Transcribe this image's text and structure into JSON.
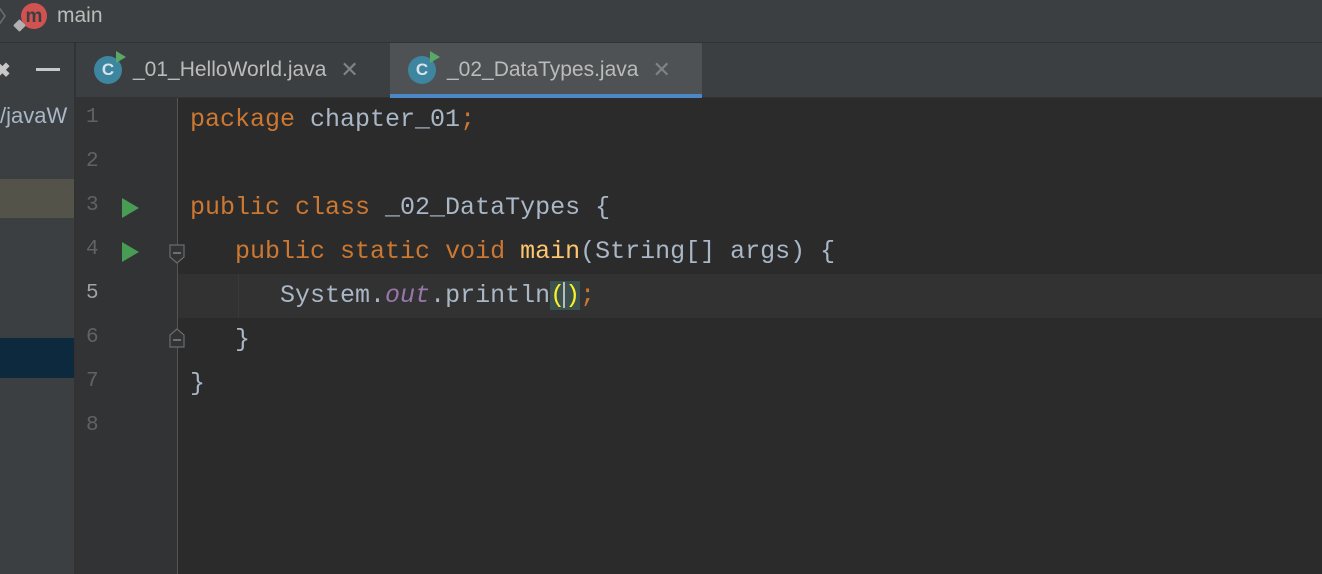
{
  "breadcrumb": {
    "method_badge": "m",
    "label": "main"
  },
  "project_panel": {
    "path_fragment": "/javaW"
  },
  "tabs": [
    {
      "label": "_01_HelloWorld.java",
      "icon": "java-class-runnable-icon",
      "active": false
    },
    {
      "label": "_02_DataTypes.java",
      "icon": "java-class-runnable-icon",
      "active": true
    }
  ],
  "tab_icon_letter": "C",
  "tab_close_glyph": "✕",
  "editor": {
    "line_numbers": [
      "1",
      "2",
      "3",
      "4",
      "5",
      "6",
      "7",
      "8"
    ],
    "current_line": 5,
    "run_markers_on_lines": [
      3,
      4
    ],
    "fold_markers_on_lines": [
      4,
      6
    ],
    "code": {
      "l1_kw": "package",
      "l1_rest": " chapter_01",
      "l1_semi": ";",
      "l3_kw1": "public",
      "l3_kw2": "class",
      "l3_rest": " _02_DataTypes {",
      "l4_kw1": "public",
      "l4_kw2": "static",
      "l4_kw3": "void",
      "l4_fn": "main",
      "l4_rest": "(String[] args) {",
      "l5_a": "System.",
      "l5_field": "out",
      "l5_b": ".println",
      "l5_open": "(",
      "l5_close": ")",
      "l5_semi": ";",
      "l6": "}",
      "l7": "}"
    }
  },
  "colors": {
    "keyword": "#cc7832",
    "function": "#ffc66d",
    "field": "#9876aa",
    "text": "#a9b7c6",
    "run": "#499c54",
    "tab_underline": "#4a88c7"
  }
}
